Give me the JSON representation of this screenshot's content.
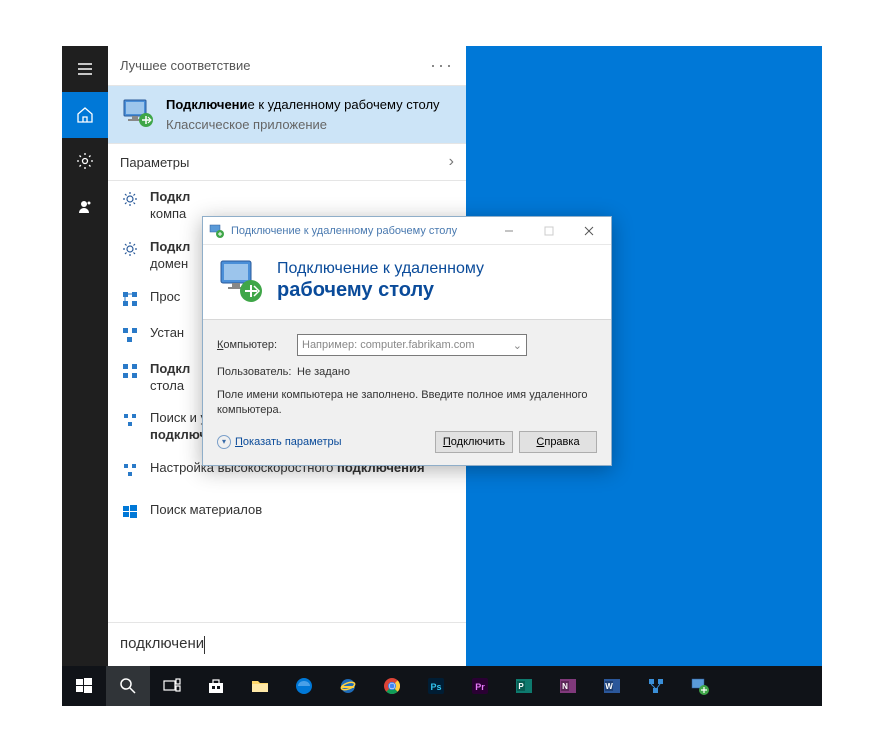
{
  "search": {
    "header": "Лучшее соответствие",
    "best_match": {
      "title_pre": "Подключени",
      "title_post": "е к удаленному рабочему столу",
      "subtitle": "Классическое приложение"
    },
    "section_label": "Параметры",
    "items": [
      {
        "pre": "Подкл",
        "post": "",
        "tail": "компа"
      },
      {
        "pre": "Подкл",
        "post": "",
        "tail": "домен"
      },
      {
        "pre": "Прос",
        "post": "",
        "tail": ""
      },
      {
        "pre": "Устан",
        "post": "",
        "tail": ""
      },
      {
        "pre": "Подкл",
        "post": "",
        "tail": "стола"
      },
      {
        "pre": "Поиск и устранение проблем с сетью и ",
        "bold": "подключени",
        "post": "ем",
        "tail": ""
      },
      {
        "pre": "Настройка высокоскоростного ",
        "bold": "подключения",
        "post": "",
        "tail": ""
      }
    ],
    "footer_item": "Поиск материалов",
    "input_value": "подключени"
  },
  "rdp": {
    "titlebar": "Подключение к удаленному рабочему столу",
    "header_line1": "Подключение к удаленному",
    "header_line2": "рабочему столу",
    "label_computer": "Компьютер:",
    "combo_placeholder": "Например: computer.fabrikam.com",
    "label_user": "Пользователь:",
    "user_value": "Не задано",
    "hint": "Поле имени компьютера не заполнено. Введите полное имя удаленного компьютера.",
    "expand_label": "Показать параметры",
    "btn_connect": "Подключить",
    "btn_help": "Справка"
  }
}
